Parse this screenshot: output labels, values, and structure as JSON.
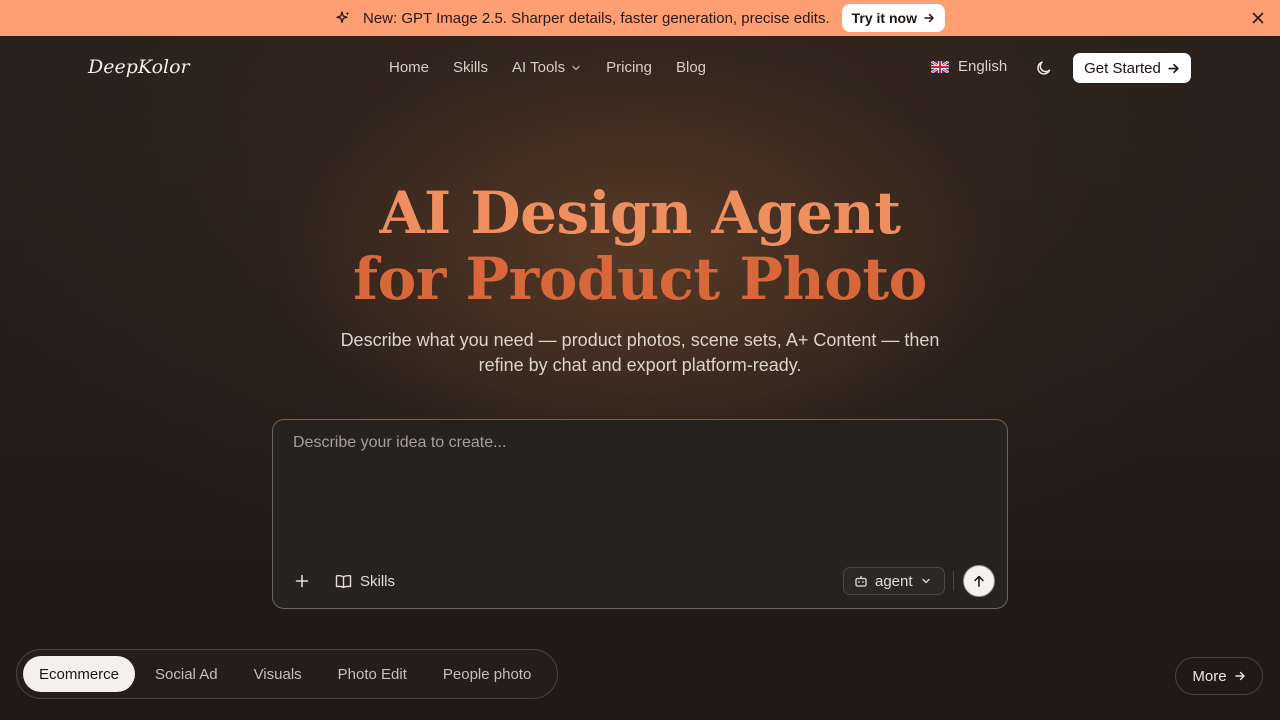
{
  "announcement": {
    "text": "New: GPT Image 2.5. Sharper details, faster generation, precise edits.",
    "cta_label": "Try it now",
    "background": "#fd9f72"
  },
  "nav": {
    "logo": "DeepKolor",
    "links": [
      "Home",
      "Skills",
      "AI Tools",
      "Pricing",
      "Blog"
    ],
    "language": "English",
    "get_started_label": "Get Started"
  },
  "hero": {
    "title_line1": "AI Design Agent",
    "title_line2": "for Product Photo",
    "subtitle": "Describe what you need — product photos, scene sets, A+ Content — then refine by chat and export platform-ready.",
    "accent_color": "#e8804f"
  },
  "composer": {
    "placeholder": "Describe your idea to create...",
    "skills_label": "Skills",
    "mode_value": "agent"
  },
  "categories": {
    "items": [
      "Ecommerce",
      "Social Ad",
      "Visuals",
      "Photo Edit",
      "People photo"
    ],
    "active": "Ecommerce",
    "more_label": "More"
  }
}
